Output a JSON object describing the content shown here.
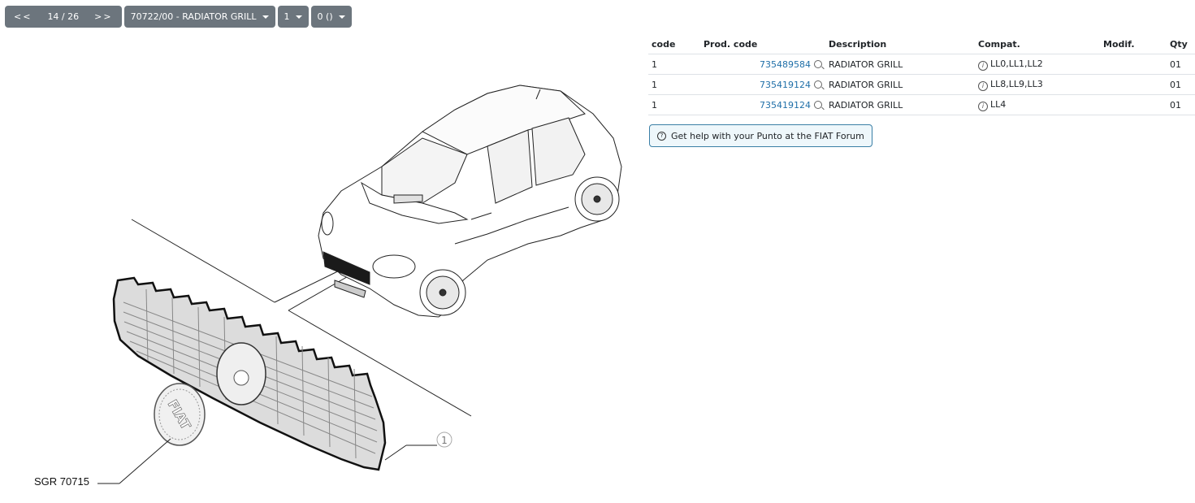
{
  "toolbar": {
    "prev_label": "<<",
    "page_label": "14 / 26",
    "next_label": ">>",
    "group_label": "70722/00 - RADIATOR GRILL",
    "variant_label": "1",
    "filter_label": "0 ()"
  },
  "diagram": {
    "callout_number": "1",
    "reference_label": "SGR 70715",
    "emblem_text": "FIAT"
  },
  "table": {
    "headers": [
      "code",
      "Prod. code",
      "Description",
      "Compat.",
      "Modif.",
      "Qty"
    ],
    "rows": [
      {
        "code": "1",
        "prod_code": "735489584",
        "description": "RADIATOR GRILL",
        "compat": "LL0,LL1,LL2",
        "modif": "",
        "qty": "01"
      },
      {
        "code": "1",
        "prod_code": "735419124",
        "description": "RADIATOR GRILL",
        "compat": "LL8,LL9,LL3",
        "modif": "",
        "qty": "01"
      },
      {
        "code": "1",
        "prod_code": "735419124",
        "description": "RADIATOR GRILL",
        "compat": "LL4",
        "modif": "",
        "qty": "01"
      }
    ]
  },
  "forum": {
    "label": "Get help with your Punto at the FIAT Forum"
  },
  "icons": {
    "search": "magnifier-icon",
    "info": "info-circle-icon",
    "help": "question-circle-icon"
  },
  "colors": {
    "toolbar_bg": "#6c757d",
    "link": "#1f6fa8",
    "forum_border": "#3a7fa6",
    "forum_bg": "#eef7fb"
  }
}
